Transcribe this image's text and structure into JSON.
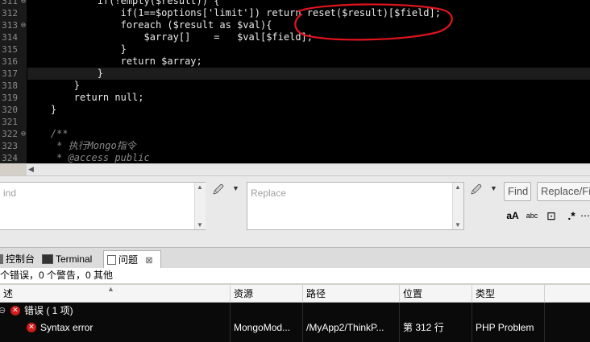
{
  "editor": {
    "lines": [
      {
        "num": "311",
        "fold": "⊖",
        "code": "            if(!empty($result)) {"
      },
      {
        "num": "312",
        "fold": "",
        "code": "                if(1==$options['limit']) return reset($result)[$field];"
      },
      {
        "num": "313",
        "fold": "⊖",
        "code": "                foreach ($result as $val){"
      },
      {
        "num": "314",
        "fold": "",
        "code": "                    $array[]    =   $val[$field];"
      },
      {
        "num": "315",
        "fold": "",
        "code": "                }"
      },
      {
        "num": "316",
        "fold": "",
        "code": "                return $array;"
      },
      {
        "num": "317",
        "fold": "",
        "code": "            }"
      },
      {
        "num": "318",
        "fold": "",
        "code": "        }"
      },
      {
        "num": "319",
        "fold": "",
        "code": "        return null;"
      },
      {
        "num": "320",
        "fold": "",
        "code": "    }"
      },
      {
        "num": "321",
        "fold": "",
        "code": ""
      },
      {
        "num": "322",
        "fold": "⊖",
        "code": "    /**"
      },
      {
        "num": "323",
        "fold": "",
        "code": "     * 执行Mongo指令"
      },
      {
        "num": "324",
        "fold": "",
        "code": "     * @access public"
      }
    ]
  },
  "find_panel": {
    "find_placeholder": "ind",
    "replace_placeholder": "Replace",
    "find_button": "Find",
    "replace_find_button": "Replace/Fi",
    "tools": {
      "match_case": "aA",
      "regex": "abc",
      "whole_word": "⊡",
      "in_selection": ".*",
      "more": "⋯"
    }
  },
  "tabs": [
    {
      "label": "控制台",
      "icon": "console-icon"
    },
    {
      "label": "Terminal",
      "icon": "terminal-icon"
    },
    {
      "label": "问题",
      "icon": "problems-icon",
      "close": "⊠"
    }
  ],
  "summary": "个错误，0 个警告，0 其他",
  "table": {
    "columns": [
      "述",
      "资源",
      "路径",
      "位置",
      "类型"
    ],
    "group_row": {
      "label": "错误 ( 1 项)"
    },
    "rows": [
      {
        "description": "Syntax error",
        "resource": "MongoMod...",
        "path": "/MyApp2/ThinkP...",
        "location": "第 312 行",
        "type": "PHP Problem"
      }
    ]
  },
  "colors": {
    "annotation": "#e0141e",
    "error": "#d21b1b",
    "editor_bg": "#000000"
  }
}
